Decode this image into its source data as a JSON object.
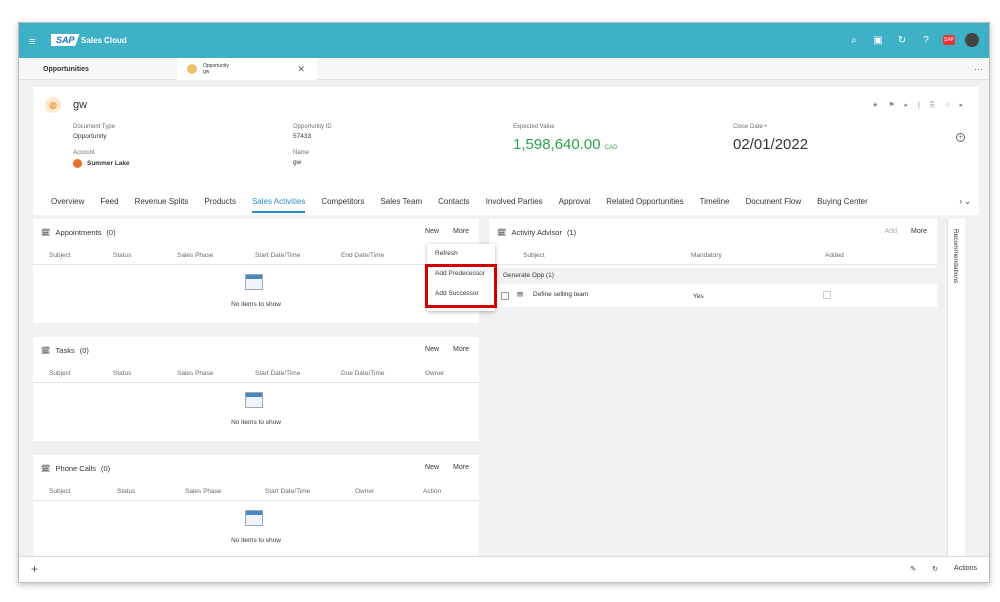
{
  "shell": {
    "logo": "SAP",
    "app_name": "Sales Cloud",
    "notif_count": "SAP"
  },
  "tabs": {
    "tab1": "Opportunities",
    "tab2_line1": "Opportunity",
    "tab2_line2": "gw",
    "close": "✕",
    "more": "···"
  },
  "header": {
    "title": "gw",
    "fields": {
      "doc_type_label": "Document Type",
      "doc_type_value": "Opportunity",
      "account_label": "Account",
      "account_value": "Summer Lake",
      "opp_id_label": "Opportunity ID",
      "opp_id_value": "57433",
      "name_label": "Name",
      "name_value": "gw",
      "expected_label": "Expected Value",
      "expected_value": "1,598,640.00",
      "expected_currency": "CAD",
      "close_label": "Close Date •",
      "close_value": "02/01/2022"
    }
  },
  "navtabs": [
    "Overview",
    "Feed",
    "Revenue Splits",
    "Products",
    "Sales Activities",
    "Competitors",
    "Sales Team",
    "Contacts",
    "Involved Parties",
    "Approval",
    "Related Opportunities",
    "Timeline",
    "Document Flow",
    "Buying Center"
  ],
  "appointments": {
    "title": "Appointments",
    "count": "(0)",
    "new": "New",
    "more": "More",
    "cols": [
      "Subject",
      "Status",
      "Sales Phase",
      "Start Date/Time",
      "End Date/Time"
    ],
    "empty": "No items to show"
  },
  "tasks": {
    "title": "Tasks",
    "count": "(0)",
    "new": "New",
    "more": "More",
    "cols": [
      "Subject",
      "Status",
      "Sales Phase",
      "Start Date/Time",
      "Due Date/Time",
      "Owner"
    ],
    "empty": "No items to show"
  },
  "phone_calls": {
    "title": "Phone Calls",
    "count": "(0)",
    "new": "New",
    "more": "More",
    "cols": [
      "Subject",
      "Status",
      "Sales Phase",
      "Start Date/Time",
      "Owner",
      "Action"
    ],
    "empty": "No items to show"
  },
  "dropdown": {
    "refresh": "Refresh",
    "add_pred": "Add Predecessor",
    "add_succ": "Add Successor"
  },
  "advisor": {
    "title": "Activity Advisor",
    "count": "(1)",
    "add": "Add",
    "more": "More",
    "cols": [
      "Subject",
      "Mandatory",
      "Added"
    ],
    "group": "Generate Opp (1)",
    "row_subject": "Define selling team",
    "row_mandatory": "Yes"
  },
  "side_panel": "Recommendations",
  "footer": {
    "actions": "Actions"
  }
}
